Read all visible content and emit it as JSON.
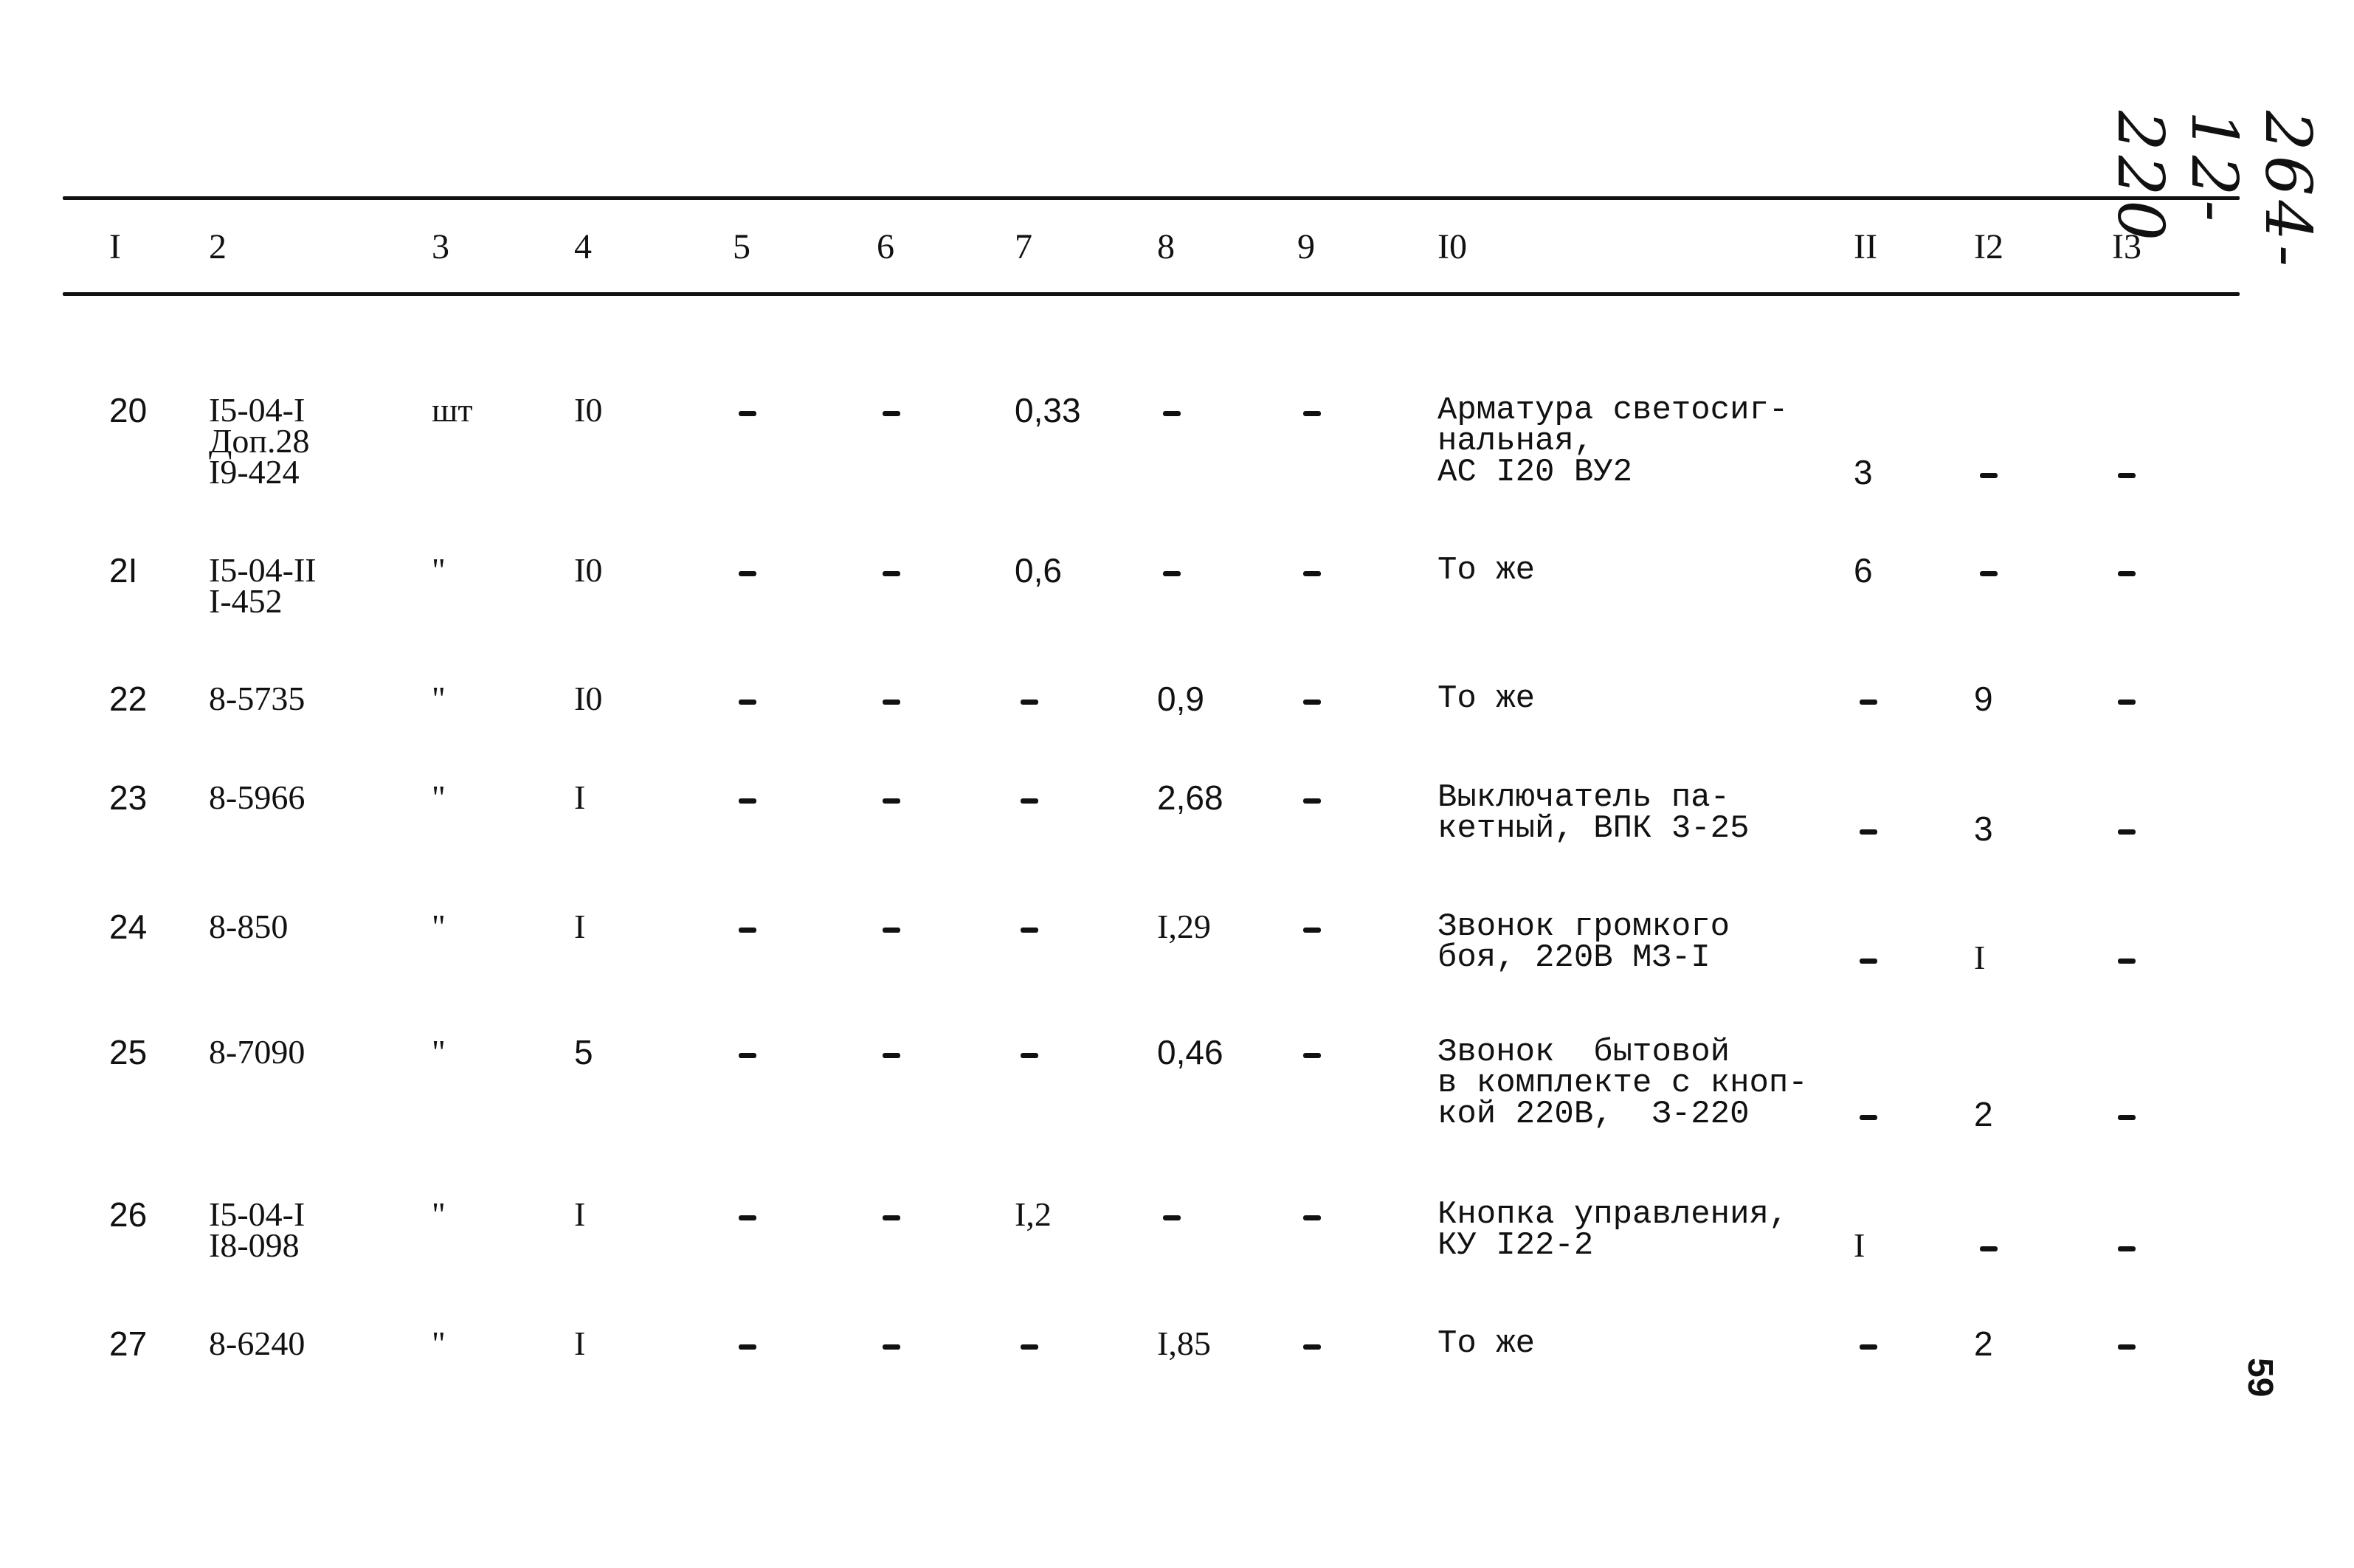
{
  "document": {
    "handwritten_code": "264-12-220",
    "page_number": "59"
  },
  "table": {
    "headers": [
      "I",
      "2",
      "3",
      "4",
      "5",
      "6",
      "7",
      "8",
      "9",
      "I0",
      "II",
      "I2",
      "I3"
    ],
    "rows": [
      {
        "c1": "20",
        "c2": [
          "I5-04-I",
          "Доп.28",
          "I9-424"
        ],
        "c3": "шт",
        "c4": "I0",
        "c5": "-",
        "c6": "-",
        "c7": "0,33",
        "c8": "-",
        "c9": "-",
        "c10": [
          "Арматура светосиг-",
          "нальная,",
          "АС I20 ВУ2"
        ],
        "c11": "3",
        "c12": "-",
        "c13": "-"
      },
      {
        "c1": "2I",
        "c2": [
          "I5-04-II",
          "I-452"
        ],
        "c3": "\"",
        "c4": "I0",
        "c5": "-",
        "c6": "-",
        "c7": "0,6",
        "c8": "-",
        "c9": "-",
        "c10": [
          "То же"
        ],
        "c11": "6",
        "c12": "-",
        "c13": "-"
      },
      {
        "c1": "22",
        "c2": [
          "8-5735"
        ],
        "c3": "\"",
        "c4": "I0",
        "c5": "-",
        "c6": "-",
        "c7": "-",
        "c8": "0,9",
        "c9": "-",
        "c10": [
          "То же"
        ],
        "c11": "-",
        "c12": "9",
        "c13": "-"
      },
      {
        "c1": "23",
        "c2": [
          "8-5966"
        ],
        "c3": "\"",
        "c4": "I",
        "c5": "-",
        "c6": "-",
        "c7": "-",
        "c8": "2,68",
        "c9": "-",
        "c10": [
          "Выключатель па-",
          "кетный, ВПК 3-25"
        ],
        "c11": "-",
        "c12": "3",
        "c13": "-"
      },
      {
        "c1": "24",
        "c2": [
          "8-850"
        ],
        "c3": "\"",
        "c4": "I",
        "c5": "-",
        "c6": "-",
        "c7": "-",
        "c8": "I,29",
        "c9": "-",
        "c10": [
          "Звонок громкого",
          "боя, 220В МЗ-I"
        ],
        "c11": "-",
        "c12": "I",
        "c13": "-"
      },
      {
        "c1": "25",
        "c2": [
          "8-7090"
        ],
        "c3": "\"",
        "c4": "5",
        "c5": "-",
        "c6": "-",
        "c7": "-",
        "c8": "0,46",
        "c9": "-",
        "c10": [
          "Звонок  бытовой",
          "в комплекте с кноп-",
          "кой 220В,  З-220"
        ],
        "c11": "-",
        "c12": "2",
        "c13": "-"
      },
      {
        "c1": "26",
        "c2": [
          "I5-04-I",
          "I8-098"
        ],
        "c3": "\"",
        "c4": "I",
        "c5": "-",
        "c6": "-",
        "c7": "I,2",
        "c8": "-",
        "c9": "-",
        "c10": [
          "Кнопка управления,",
          "КУ I22-2"
        ],
        "c11": "I",
        "c12": "-",
        "c13": "-"
      },
      {
        "c1": "27",
        "c2": [
          "8-6240"
        ],
        "c3": "\"",
        "c4": "I",
        "c5": "-",
        "c6": "-",
        "c7": "-",
        "c8": "I,85",
        "c9": "-",
        "c10": [
          "То же"
        ],
        "c11": "-",
        "c12": "2",
        "c13": "-"
      }
    ]
  }
}
